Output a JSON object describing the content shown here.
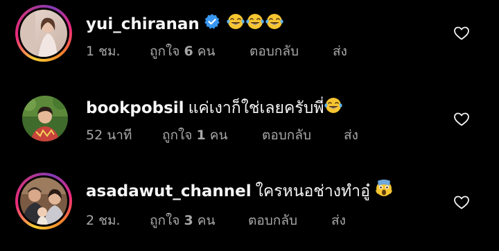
{
  "comments": [
    {
      "username": "yui_chiranan",
      "verified": true,
      "text": "",
      "emoji": [
        "face-with-tears-of-joy",
        "face-with-tears-of-joy",
        "face-with-tears-of-joy"
      ],
      "time": "1 ชม.",
      "likes_prefix": "ถูกใจ",
      "likes_count": "6",
      "likes_suffix": "คน",
      "reply_label": "ตอบกลับ",
      "send_label": "ส่ง",
      "has_story_ring": true
    },
    {
      "username": "bookpobsil",
      "verified": false,
      "text": "แค่เงาก็ใช่เลยครับพี่",
      "emoji": [
        "face-with-tears-of-joy"
      ],
      "time": "52 นาที",
      "likes_prefix": "ถูกใจ",
      "likes_count": "1",
      "likes_suffix": "คน",
      "reply_label": "ตอบกลับ",
      "send_label": "ส่ง",
      "has_story_ring": false
    },
    {
      "username": "asadawut_channel",
      "verified": false,
      "text": "ใครหนอช่างทำอู๋",
      "emoji": [
        "face-screaming-in-fear"
      ],
      "time": "2 ชม.",
      "likes_prefix": "ถูกใจ",
      "likes_count": "3",
      "likes_suffix": "คน",
      "reply_label": "ตอบกลับ",
      "send_label": "ส่ง",
      "has_story_ring": true
    }
  ],
  "colors": {
    "background": "#000000",
    "text_primary": "#f5f5f5",
    "text_secondary": "#a8a8a8",
    "verified_blue": "#3897f0",
    "emoji_yellow": "#f7c531"
  }
}
